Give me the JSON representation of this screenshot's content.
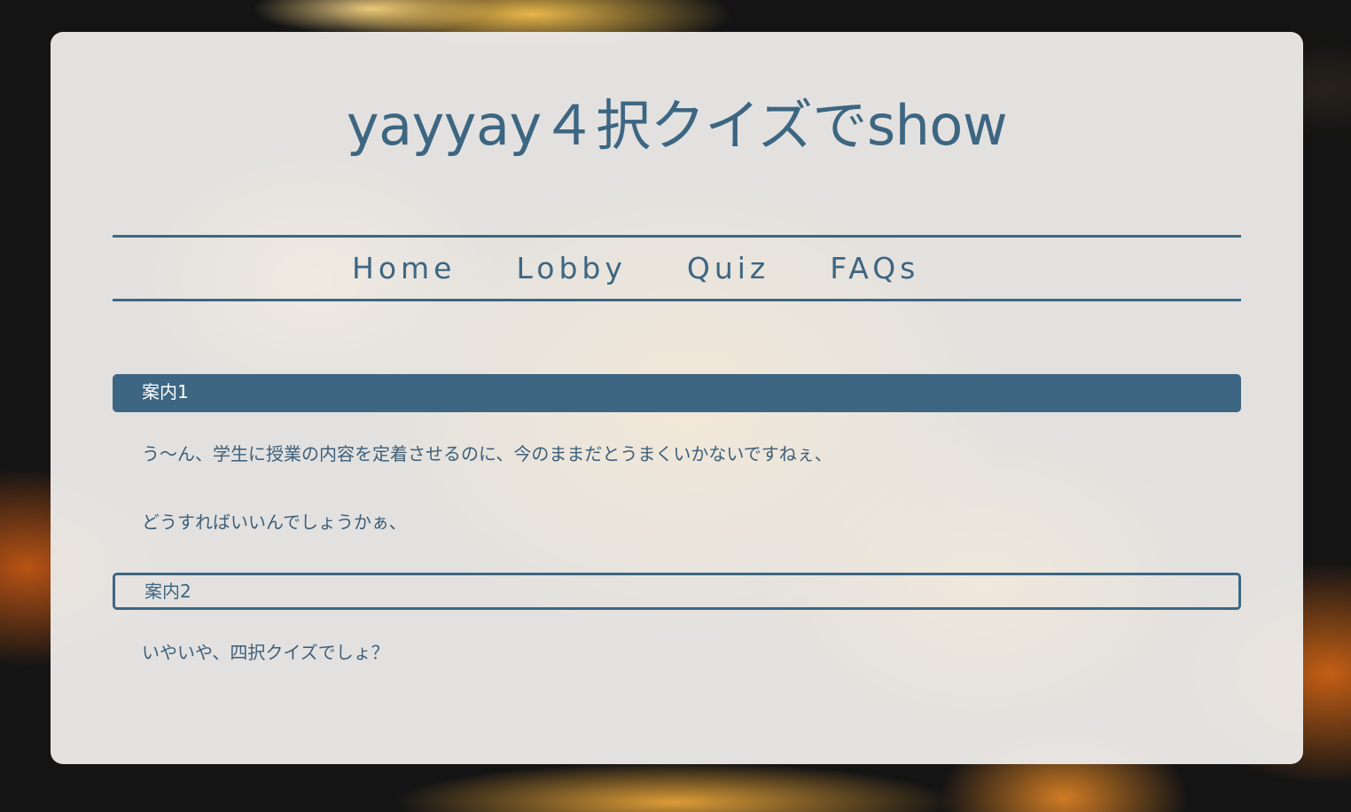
{
  "site": {
    "title": "yayyay４択クイズでshow"
  },
  "nav": {
    "items": [
      {
        "label": "Home"
      },
      {
        "label": "Lobby"
      },
      {
        "label": "Quiz"
      },
      {
        "label": "FAQs"
      }
    ]
  },
  "sections": [
    {
      "heading": "案内1",
      "style": "filled",
      "paragraphs": [
        "う～ん、学生に授業の内容を定着させるのに、今のままだとうまくいかないですねぇ、",
        "どうすればいいんでしょうかぁ、"
      ]
    },
    {
      "heading": "案内2",
      "style": "outline",
      "paragraphs": [
        "いやいや、四択クイズでしょ？"
      ]
    }
  ],
  "colors": {
    "accent": "#3d6682",
    "card_background": "#ecebe9",
    "page_background": "#141414"
  }
}
